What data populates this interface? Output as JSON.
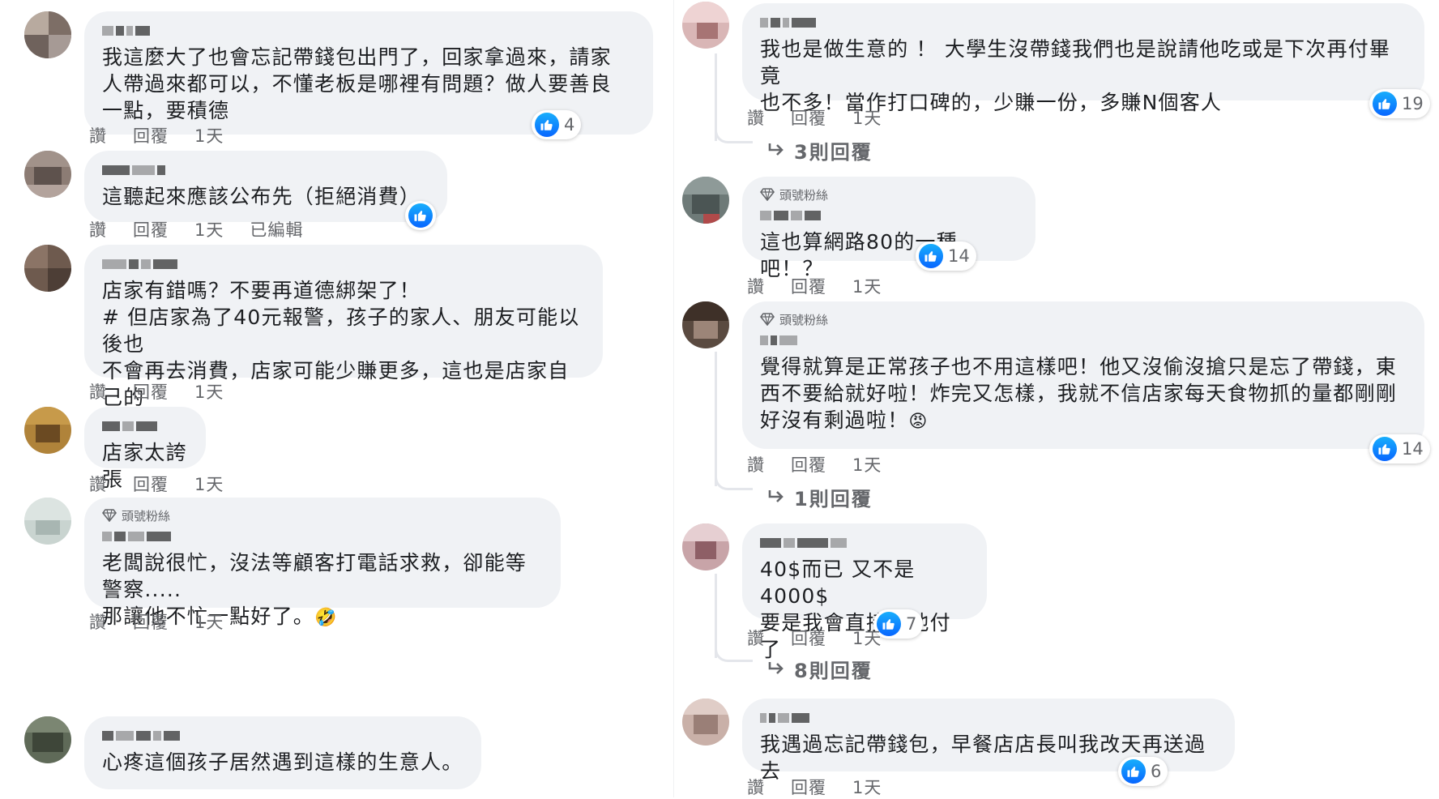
{
  "ui": {
    "like": "讚",
    "reply": "回覆",
    "edited": "已編輯",
    "top_fan": "頭號粉絲"
  },
  "left": [
    {
      "time": "1天",
      "text": "我這麼大了也會忘記帶錢包出門了，回家拿過來，請家\n人帶過來都可以，不懂老板是哪裡有問題？做人要善良\n一點，要積德",
      "likes": "4"
    },
    {
      "time": "1天",
      "text": "這聽起來應該公布先（拒絕消費）",
      "likes": ""
    },
    {
      "time": "1天",
      "text": "店家有錯嗎？不要再道德綁架了！\n# 但店家為了40元報警，孩子的家人、朋友可能以後也\n不會再去消費，店家可能少賺更多，這也是店家自己的\n選擇！"
    },
    {
      "time": "1天",
      "text": "店家太誇張"
    },
    {
      "time": "1天",
      "text": "老闆說很忙，沒法等顧客打電話求救，卻能等警察.....\n那讓他不忙一點好了。",
      "emoji": "🤣"
    },
    {
      "text": "心疼這個孩子居然遇到這樣的生意人。"
    }
  ],
  "right": [
    {
      "time": "1天",
      "text": "我也是做生意的 ！ 大學生沒帶錢我們也是說請他吃或是下次再付畢竟\n也不多！當作打口碑的，少賺一份，多賺N個客人",
      "likes": "19",
      "replies": "3則回覆"
    },
    {
      "time": "1天",
      "text": "這也算網路80的一種吧！？",
      "likes": "14"
    },
    {
      "time": "1天",
      "text": "覺得就算是正常孩子也不用這樣吧！他又沒偷沒搶只是忘了帶錢，東\n西不要給就好啦！炸完又怎樣，我就不信店家每天食物抓的量都剛剛\n好沒有剩過啦！",
      "emoji": "😡",
      "likes": "14",
      "replies": "1則回覆"
    },
    {
      "time": "1天",
      "text": "40$而已 又不是4000$\n要是我會直接幫他付了",
      "likes": "7",
      "replies": "8則回覆"
    },
    {
      "time": "1天",
      "text": "我遇過忘記帶錢包，早餐店店長叫我改天再送過去",
      "likes": "6"
    }
  ],
  "colors": {
    "bubble": "#f0f2f5",
    "meta": "#65676b",
    "like_blue": "#0866ff"
  }
}
